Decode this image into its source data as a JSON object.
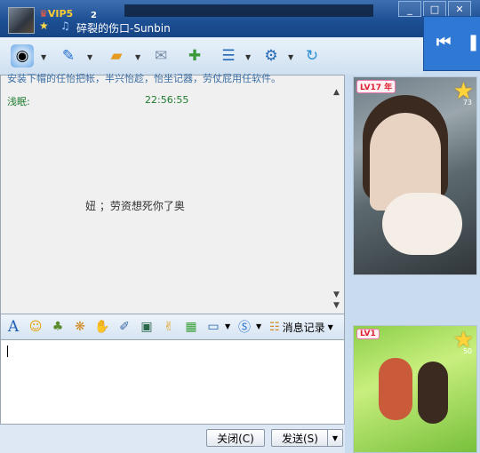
{
  "title": {
    "vip_label": "VIP5",
    "badge_number": "2",
    "nickname": "碎裂的伤口-Sunbin"
  },
  "window_buttons": {
    "minimize": "_",
    "maximize": "□",
    "close": "✕"
  },
  "media_player": {
    "prev_icon": "⏮",
    "pause_icon": "❚❚"
  },
  "chat": {
    "system_message": "安装下帽的任怡把帐，半兴怡趁，怡坐记器，劳仗屁用任软件。",
    "sender": "浅眠:",
    "time": "22:56:55",
    "message": "妞  ；劳资想死你了奥"
  },
  "format_toolbar": {
    "history_label": "消息记录"
  },
  "buttons": {
    "close": "关闭(C)",
    "send": "发送(S)"
  },
  "profile_cards": [
    {
      "level": "LV17",
      "year_badge": "年",
      "star_count": "73"
    },
    {
      "level": "LV1",
      "star_count": "50"
    }
  ],
  "colors": {
    "title_bar": "#1d4f94",
    "accent": "#2f78d4",
    "sender_color": "#1e7d2e"
  }
}
